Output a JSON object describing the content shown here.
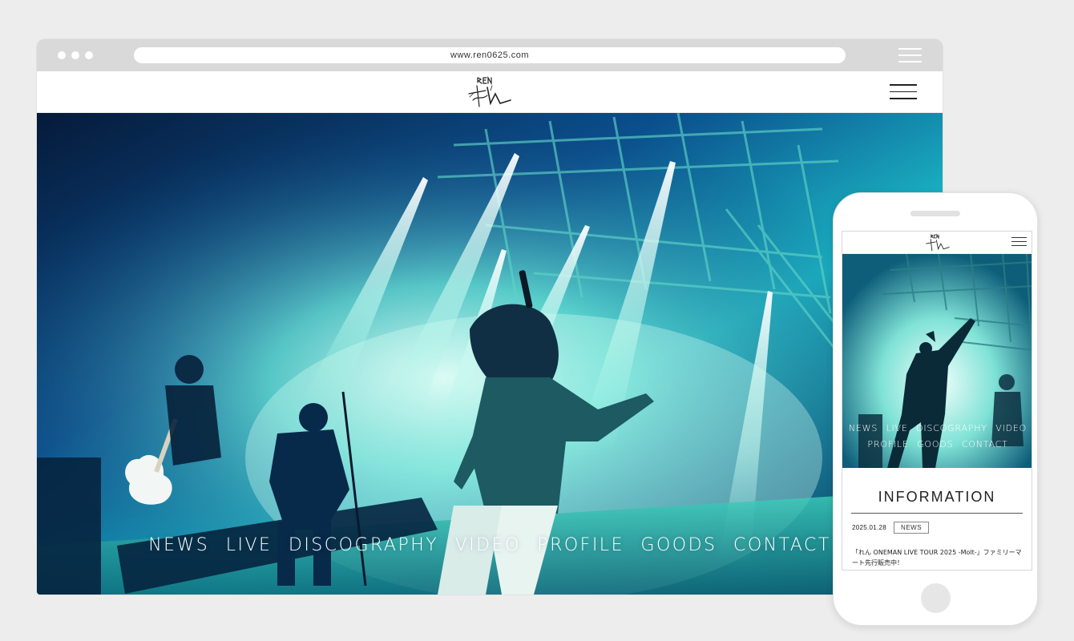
{
  "browser": {
    "url": "www.ren0625.com"
  },
  "logo": {
    "text": "REN れん",
    "icon": "ren-signature-logo"
  },
  "nav": [
    "NEWS",
    "LIVE",
    "DISCOGRAPHY",
    "VIDEO",
    "PROFILE",
    "GOODS",
    "CONTACT"
  ],
  "mobile": {
    "nav_row1": [
      "NEWS",
      "LIVE",
      "DISCOGRAPHY",
      "VIDEO"
    ],
    "nav_row2": [
      "PROFILE",
      "GOODS",
      "CONTACT"
    ],
    "info_title": "INFORMATION",
    "news": [
      {
        "date": "2025.01.28",
        "category": "NEWS",
        "text": "「れん ONEMAN LIVE TOUR 2025 -Molt-」ファミリーマート先行販売中！"
      }
    ]
  },
  "colors": {
    "background": "#ededed",
    "browser_bar": "#d9d9d9",
    "stage_cyan": "#2fd4c8",
    "stage_blue": "#0a3f8a"
  }
}
